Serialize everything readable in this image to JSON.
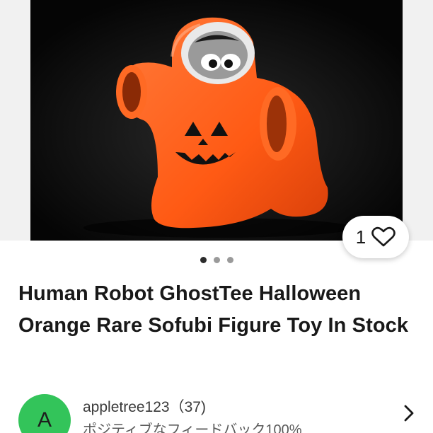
{
  "listing": {
    "image_description_icon": "product-photo",
    "favorite_count": "1",
    "carousel_dots": 3,
    "carousel_active_index": 0,
    "title": "Human Robot GhostTee Halloween Orange Rare Sofubi Figure Toy In Stock"
  },
  "seller": {
    "avatar_letter": "A",
    "name_with_count": "appletree123（37)",
    "feedback": "ポジティブなフィードバック100%"
  },
  "colors": {
    "accent_green": "#33c45a",
    "figure_orange": "#ff5a14"
  }
}
